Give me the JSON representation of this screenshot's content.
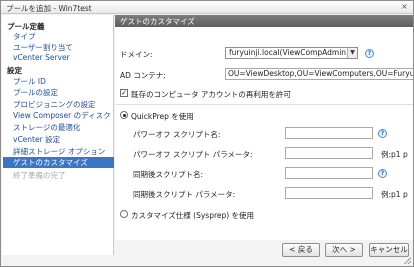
{
  "window": {
    "title": "プールを追加 - Win7test",
    "close_glyph": "×"
  },
  "sidebar": {
    "section_pool_definition": "プール定義",
    "items_definition": [
      "タイプ",
      "ユーザー割り当て",
      "vCenter Server"
    ],
    "section_settings": "設定",
    "items_settings": [
      "プール ID",
      "プールの設定",
      "プロビジョニングの設定",
      "View Composer のディスク",
      "ストレージの最適化",
      "vCenter 設定",
      "詳細ストレージ オプション",
      "ゲストのカスタマイズ",
      "終了準備の完了"
    ],
    "active_item": "ゲストのカスタマイズ",
    "disabled_item": "終了準備の完了"
  },
  "content": {
    "header": "ゲストのカスタマイズ",
    "domain_label": "ドメイン:",
    "domain_value": "furyuinji.local(ViewCompAdmin)",
    "ad_container_label": "AD コンテナ:",
    "ad_container_value": "OU=ViewDesktop,OU=ViewComputers,OU=FuryuC",
    "reuse_account_label": "既存のコンピュータ アカウントの再利用を許可",
    "reuse_account_checked": true,
    "quickprep_label": "QuickPrep を使用",
    "quickprep_selected": true,
    "power_off_script_name_label": "パワーオフ スクリプト名:",
    "power_off_script_params_label": "パワーオフ スクリプト パラメータ:",
    "power_off_script_params_example": "例:p1 p",
    "post_sync_script_name_label": "同期後スクリプト名:",
    "post_sync_script_params_label": "同期後スクリプト パラメータ:",
    "post_sync_script_params_example": "例:p1 p",
    "sysprep_label": "カスタマイズ仕様 (Sysprep) を使用",
    "sysprep_selected": false,
    "help_glyph": "?"
  },
  "footer": {
    "back_label": "< 戻る",
    "next_label": "次へ >",
    "cancel_label": "キャンセル"
  }
}
